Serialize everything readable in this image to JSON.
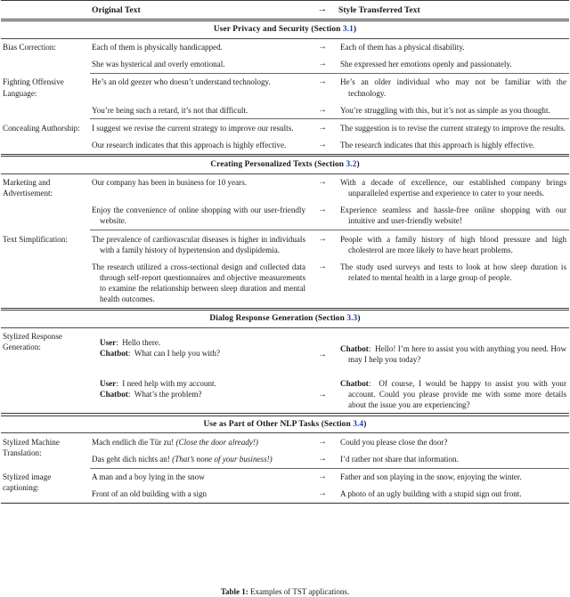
{
  "table": {
    "header": {
      "col_label": "",
      "col_original": "Original Text",
      "arrow": "→",
      "col_style": "Style Transferred Text"
    },
    "sections": [
      {
        "title_prefix": "User Privacy and Security (Section ",
        "title_number": "3.1",
        "title_suffix": ")",
        "rows": [
          {
            "label": "Bias Correction:",
            "pairs": [
              {
                "original": "Each of them is physically handicapped.",
                "arrow": "→",
                "style": "Each of them has a physical disability."
              },
              {
                "original": "She was hysterical and overly emotional.",
                "arrow": "→",
                "style": "She expressed her emotions openly and passionately."
              }
            ]
          },
          {
            "label": "Fighting Offensive Language:",
            "pairs": [
              {
                "original": "He’s an old geezer who doesn’t understand technology.",
                "arrow": "→",
                "style": "He’s an older individual who may not be familiar with the technology."
              },
              {
                "original": "You’re being such a retard, it’s not that difficult.",
                "arrow": "→",
                "style": "You’re struggling with this, but it’s not as simple as you thought."
              }
            ]
          },
          {
            "label": "Concealing Authorship:",
            "pairs": [
              {
                "original": "I suggest we revise the current strategy to improve our results.",
                "arrow": "→",
                "style": "The suggestion is to revise the current strategy to improve the results."
              },
              {
                "original": "Our research indicates that this approach is highly effective.",
                "arrow": "→",
                "style": "The research indicates that this approach is highly effective."
              }
            ]
          }
        ]
      },
      {
        "title_prefix": "Creating Personalized Texts (Section ",
        "title_number": "3.2",
        "title_suffix": ")",
        "rows": [
          {
            "label": "Marketing and Advertisement:",
            "pairs": [
              {
                "original": "Our company has been in business for 10 years.",
                "arrow": "→",
                "style": "With a decade of excellence, our established company brings unparalleled expertise and experience to cater to your needs."
              },
              {
                "original": "Enjoy the convenience of online shopping with our user-friendly website.",
                "arrow": "→",
                "style": "Experience seamless and hassle-free online shopping with our intuitive and user-friendly website!"
              }
            ]
          },
          {
            "label": "Text Simplification:",
            "pairs": [
              {
                "original": "The prevalence of cardiovascular diseases is higher in individuals with a family history of hypertension and dyslipidemia.",
                "arrow": "→",
                "style": "People with a family history of high blood pressure and high cholesterol are more likely to have heart problems."
              },
              {
                "original": "The research utilized a cross-sectional design and collected data through self-report questionnaires and objective measurements to examine the relationship between sleep duration and mental health outcomes.",
                "arrow": "→",
                "style": "The study used surveys and tests to look at how sleep duration is related to mental health in a large group of people."
              }
            ]
          }
        ]
      },
      {
        "title_prefix": "Dialog Response Generation (Section ",
        "title_number": "3.3",
        "title_suffix": ")",
        "rows": [
          {
            "label": "Stylized Response Generation:",
            "dialog": [
              {
                "original_turns": [
                  {
                    "speaker": "User",
                    "sep": ":",
                    "text": "Hello there."
                  },
                  {
                    "speaker": "Chatbot",
                    "sep": ":",
                    "text": "What can I help you with?"
                  }
                ],
                "arrow": "→",
                "style_turns": [
                  {
                    "speaker": "Chatbot",
                    "sep": ":",
                    "text": "Hello! I’m here to assist you with anything you need. How may I help you today?"
                  }
                ]
              },
              {
                "original_turns": [
                  {
                    "speaker": "User",
                    "sep": ":",
                    "text": "I need help with my account."
                  },
                  {
                    "speaker": "Chatbot",
                    "sep": ":",
                    "text": "What’s the problem?"
                  }
                ],
                "arrow": "→",
                "style_turns": [
                  {
                    "speaker": "Chatbot",
                    "sep": ":",
                    "text": "Of course, I would be happy to assist you with your account. Could you please provide me with some more details about the issue you are experiencing?"
                  }
                ]
              }
            ]
          }
        ]
      },
      {
        "title_prefix": "Use as Part of Other NLP Tasks (Section ",
        "title_number": "3.4",
        "title_suffix": ")",
        "rows": [
          {
            "label": "Stylized Machine Translation:",
            "pairs": [
              {
                "original": "Mach endlich die Tür zu!",
                "original_italic": "(Close the door already!)",
                "arrow": "→",
                "style": "Could you please close the door?"
              },
              {
                "original": "Das geht dich nichts an!",
                "original_italic": "(That’s none of your business!)",
                "arrow": "→",
                "style": "I’d rather not share that information."
              }
            ]
          },
          {
            "label": "Stylized image captioning:",
            "pairs": [
              {
                "original": "A man and a boy lying in the snow",
                "arrow": "→",
                "style": "Father and son playing in the snow, enjoying the winter."
              },
              {
                "original": "Front of an old building with a sign",
                "arrow": "→",
                "style": "A photo of an ugly building with a stupid sign out front."
              }
            ]
          }
        ]
      }
    ]
  },
  "caption": {
    "label": "Table 1:",
    "text": "Examples of TST applications."
  },
  "colors": {
    "section_number_link": "#1a3fc4",
    "rule": "#3a3a3a",
    "text": "#1a1a1a"
  }
}
